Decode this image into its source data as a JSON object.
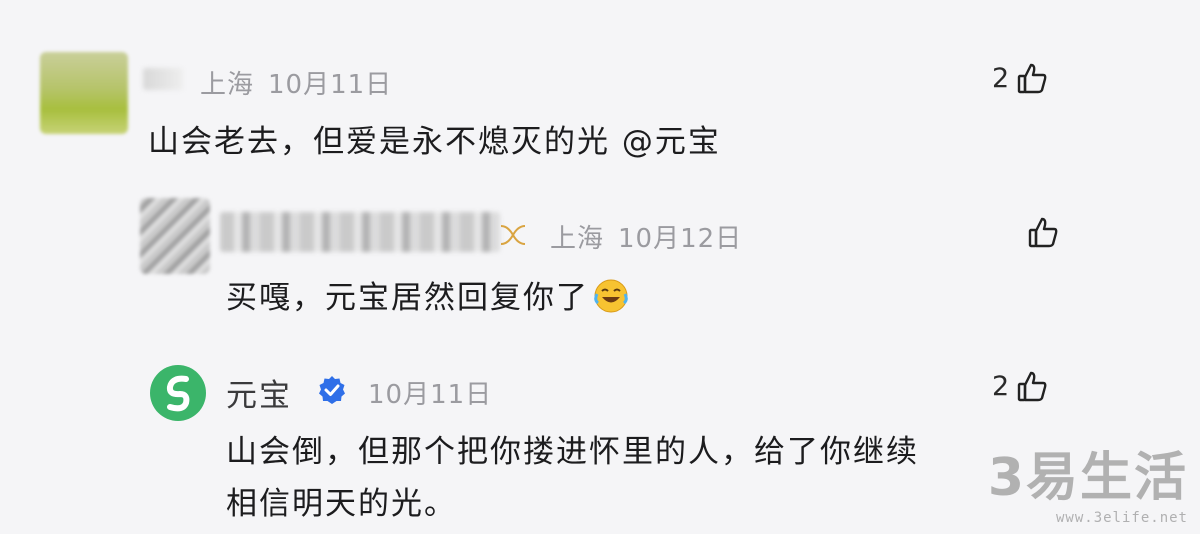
{
  "comments": [
    {
      "location": "上海",
      "date": "10月11日",
      "text": "山会老去，但爱是永不熄灭的光 @元宝",
      "likes": "2"
    },
    {
      "location": "上海",
      "date": "10月12日",
      "text": "买嘎，元宝居然回复你了",
      "emoji": "laughing-crying-emoji"
    },
    {
      "name": "元宝",
      "date": "10月11日",
      "text_line1": "山会倒，但那个把你搂进怀里的人，给了你继续",
      "text_line2": "相信明天的光。",
      "likes": "2"
    }
  ],
  "watermark": {
    "main": "3易生活",
    "url": "www.3elife.net"
  },
  "colors": {
    "meta_text": "#9b9ba0",
    "logo_green": "#3bb56a",
    "verified_blue": "#2f6fe8"
  }
}
